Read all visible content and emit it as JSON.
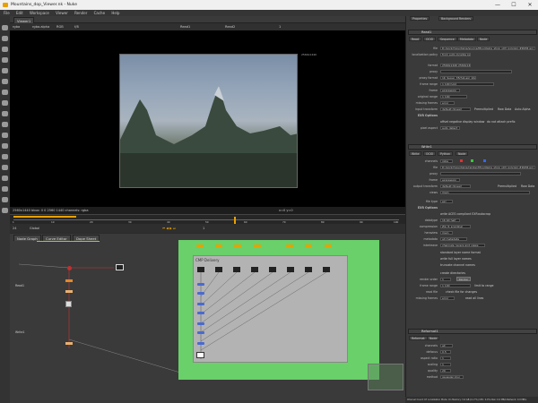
{
  "window": {
    "title": "Mountains_dop_Viewer.nk - Nuke",
    "minimize": "—",
    "maximize": "☐",
    "close": "✕"
  },
  "menu": [
    "File",
    "Edit",
    "Workspace",
    "Viewer",
    "Render",
    "Cache",
    "Help"
  ],
  "viewer": {
    "tab": "Viewer1",
    "controls": {
      "layer": "rgba",
      "channel": "rgba.alpha",
      "display": "RGB",
      "zoom": "f/8",
      "input_a": "Read1",
      "input_b": "Read2",
      "gain": "1"
    },
    "frame_label": "2560x1440",
    "info": "2560x1440 bbox: 0 0 2560 1440 channels: rgba",
    "coords": "x=0 y=0"
  },
  "timeline": {
    "frame": "1",
    "fps": "24",
    "mode": "Global",
    "ticks": [
      "1",
      "10",
      "20",
      "30",
      "40",
      "50",
      "60",
      "70",
      "80",
      "90",
      "100"
    ]
  },
  "dag_tabs": [
    "Node Graph",
    "Curve Editor",
    "Dope Sheet"
  ],
  "dag": {
    "backdrop_label": "CMP Delivery",
    "bottom_labels": [
      "Read1",
      "Write1"
    ]
  },
  "properties": {
    "tabs": [
      "Properties",
      "Background Renders"
    ],
    "read_node": {
      "name": "Read1",
      "tabs": [
        "Read",
        "OCIO",
        "Sequence",
        "Metadata",
        "Node"
      ],
      "rows": [
        {
          "label": "file",
          "value": "D:/work/mountains/source/Mountains_shop_v03_polygon.####.exr"
        },
        {
          "label": "localization policy",
          "value": "from auto-localize path"
        },
        {
          "label": "format",
          "value": "2560x1440 2560x1440"
        },
        {
          "label": "proxy",
          "value": ""
        },
        {
          "label": "proxy format",
          "value": "1K_Super_35(full-ap) 1024x778"
        },
        {
          "label": "frame range",
          "value": "1    100    hold"
        },
        {
          "label": "frame",
          "value": "expression"
        },
        {
          "label": "original range",
          "value": "1    100"
        },
        {
          "label": "missing frames",
          "value": "error"
        },
        {
          "label": "input transform",
          "value": "default (linear)"
        },
        {
          "label": "EXR Options",
          "value": ""
        },
        {
          "label": "pixel aspect",
          "value": "auto detect"
        }
      ],
      "checks": [
        "offset negative display window",
        "do not attach prefix",
        "Premultiplied",
        "Raw Data",
        "Auto Alpha"
      ]
    },
    "write_node": {
      "name": "Write1",
      "tabs": [
        "Write",
        "OCIO",
        "Python",
        "Node"
      ],
      "rows": [
        {
          "label": "channels",
          "value": "rgba"
        },
        {
          "label": "file",
          "value": "D:/work/mountains/render/Mountains_shop_v03_polygon.####.exr"
        },
        {
          "label": "proxy",
          "value": ""
        },
        {
          "label": "frame",
          "value": "expression"
        },
        {
          "label": "output transform",
          "value": "default (linear)"
        },
        {
          "label": "views",
          "value": "main"
        },
        {
          "label": "file type",
          "value": "exr"
        },
        {
          "label": "EXR Options",
          "value": ""
        },
        {
          "label": "datatype",
          "value": "16 bit half"
        },
        {
          "label": "compression",
          "value": "Zip (1 scanline)"
        },
        {
          "label": "heroview",
          "value": "main"
        },
        {
          "label": "metadata",
          "value": "all metadata"
        },
        {
          "label": "interleave",
          "value": "channels, layers and views"
        },
        {
          "label": "render order",
          "value": "1"
        },
        {
          "label": "frame range",
          "value": "1    100"
        },
        {
          "label": "read file",
          "value": ""
        },
        {
          "label": "missing frames",
          "value": "error"
        }
      ],
      "checks": [
        "write ACES compliant EXR",
        "autocrop",
        "standard layer name format",
        "write full layer names",
        "truncate channel names",
        "create directories",
        "limit to range",
        "check file for changes",
        "read all lines",
        "Premultiplied",
        "Raw Data"
      ],
      "buttons": [
        "Render"
      ]
    },
    "reformat_node": {
      "name": "Reformat1",
      "tabs": [
        "Reformat",
        "Node"
      ],
      "rows": [
        {
          "label": "channels",
          "value": "all"
        },
        {
          "label": "defocus",
          "value": "0.5"
        },
        {
          "label": "aspect ratio",
          "value": "1"
        },
        {
          "label": "scaling",
          "value": "1"
        },
        {
          "label": "quality",
          "value": "20"
        },
        {
          "label": "method",
          "value": "gaussian blur"
        }
      ]
    }
  },
  "status": "Channel Count: 67  Localization Mode: On  Memory: 3.6 GB (11.7%)  CPU: 0.0%  Disk: 0.0 MB/s  Network: 0.0 MB/s",
  "colors": {
    "accent": "#e8a000",
    "backdrop_green": "#69d06a",
    "backdrop_grey": "#b3b3b3",
    "read_node": "#c0c0c0",
    "write_node": "#e08a2c",
    "nodes_blue": "#4a6ad0"
  }
}
